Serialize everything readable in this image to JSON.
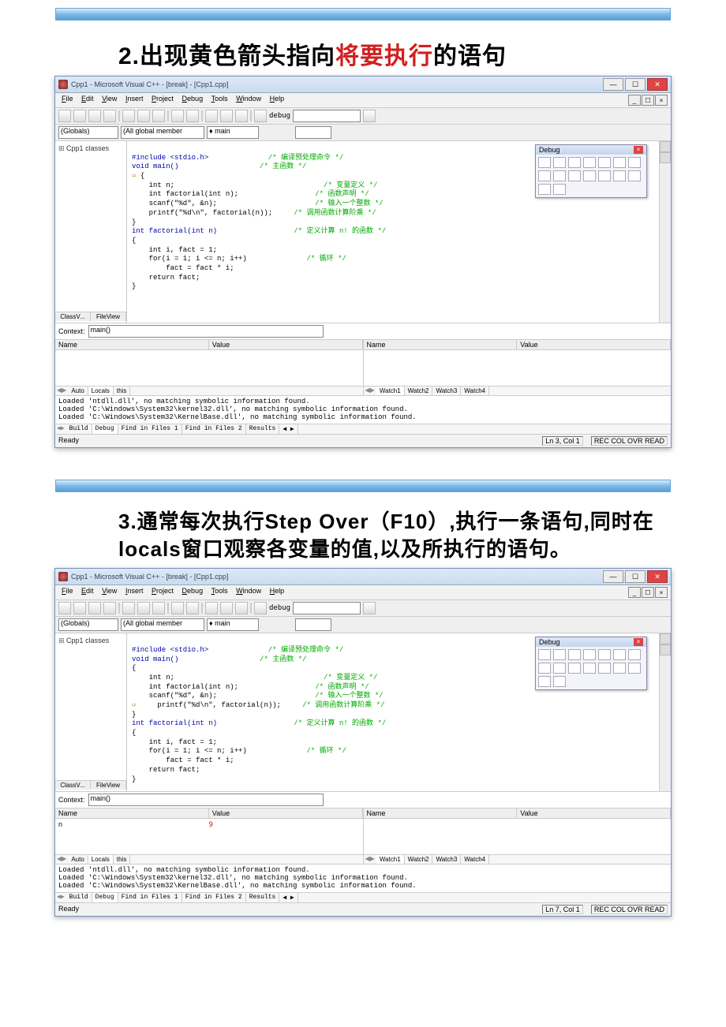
{
  "headings": {
    "h2": {
      "num": "2.",
      "pre": "出现黄色箭头指向",
      "hl": "将要执行",
      "post": "的语句"
    },
    "h3": {
      "full": "3.通常每次执行Step Over（F10）,执行一条语句,同时在locals窗口观察各变量的值,以及所执行的语句。"
    }
  },
  "window": {
    "title": "Cpp1 - Microsoft Visual C++ - [break] - [Cpp1.cpp]",
    "menus": [
      "File",
      "Edit",
      "View",
      "Insert",
      "Project",
      "Debug",
      "Tools",
      "Window",
      "Help"
    ],
    "config": "debug",
    "globals_label": "(Globals)",
    "members_label": "(All global member",
    "main_label": "main",
    "tree_root": "Cpp1 classes",
    "side_tabs": [
      "ClassV...",
      "FileView"
    ],
    "debug_float": {
      "title": "Debug"
    },
    "context_label": "Context:",
    "context_value": "main()",
    "col_name": "Name",
    "col_value": "Value",
    "locals_tabs": [
      "Auto",
      "Locals",
      "this"
    ],
    "watch_tabs": [
      "Watch1",
      "Watch2",
      "Watch3",
      "Watch4"
    ],
    "out_tabs": [
      "Build",
      "Debug",
      "Find in Files 1",
      "Find in Files 2",
      "Results"
    ],
    "status_ready": "Ready",
    "status1": {
      "ln": "Ln 3, Col 1",
      "flags": "REC COL OVR READ"
    },
    "status2": {
      "ln": "Ln 7, Col 1",
      "flags": "REC COL OVR READ"
    }
  },
  "code": {
    "l1": "#include <stdio.h>",
    "c1": "/* 编译预处理命令 */",
    "l2": "void main()",
    "c2": "/* 主函数 */",
    "l3": "{",
    "l4": "    int n;",
    "c4": "/* 变量定义 */",
    "l5": "    int factorial(int n);",
    "c5": "/* 函数声明 */",
    "l6": "    scanf(\"%d\", &n);",
    "c6": "/* 输入一个整数 */",
    "l7": "    printf(\"%d\\n\", factorial(n));",
    "c7": "/* 调用函数计算阶乘 */",
    "l8": "}",
    "l9": "int factorial(int n)",
    "c9": "/* 定义计算 n! 的函数 */",
    "l10": "{",
    "l11": "    int i, fact = 1;",
    "l12": "    for(i = 1; i <= n; i++)",
    "c12": "/* 循环 */",
    "l13": "        fact = fact * i;",
    "l14": "    return fact;",
    "l15": "}"
  },
  "output_lines": {
    "o1": "Loaded 'ntdll.dll', no matching symbolic information found.",
    "o2": "Loaded 'C:\\Windows\\System32\\kernel32.dll', no matching symbolic information found.",
    "o3": "Loaded 'C:\\Windows\\System32\\KernelBase.dll', no matching symbolic information found."
  },
  "locals2": {
    "n": "n",
    "nv": "9"
  }
}
